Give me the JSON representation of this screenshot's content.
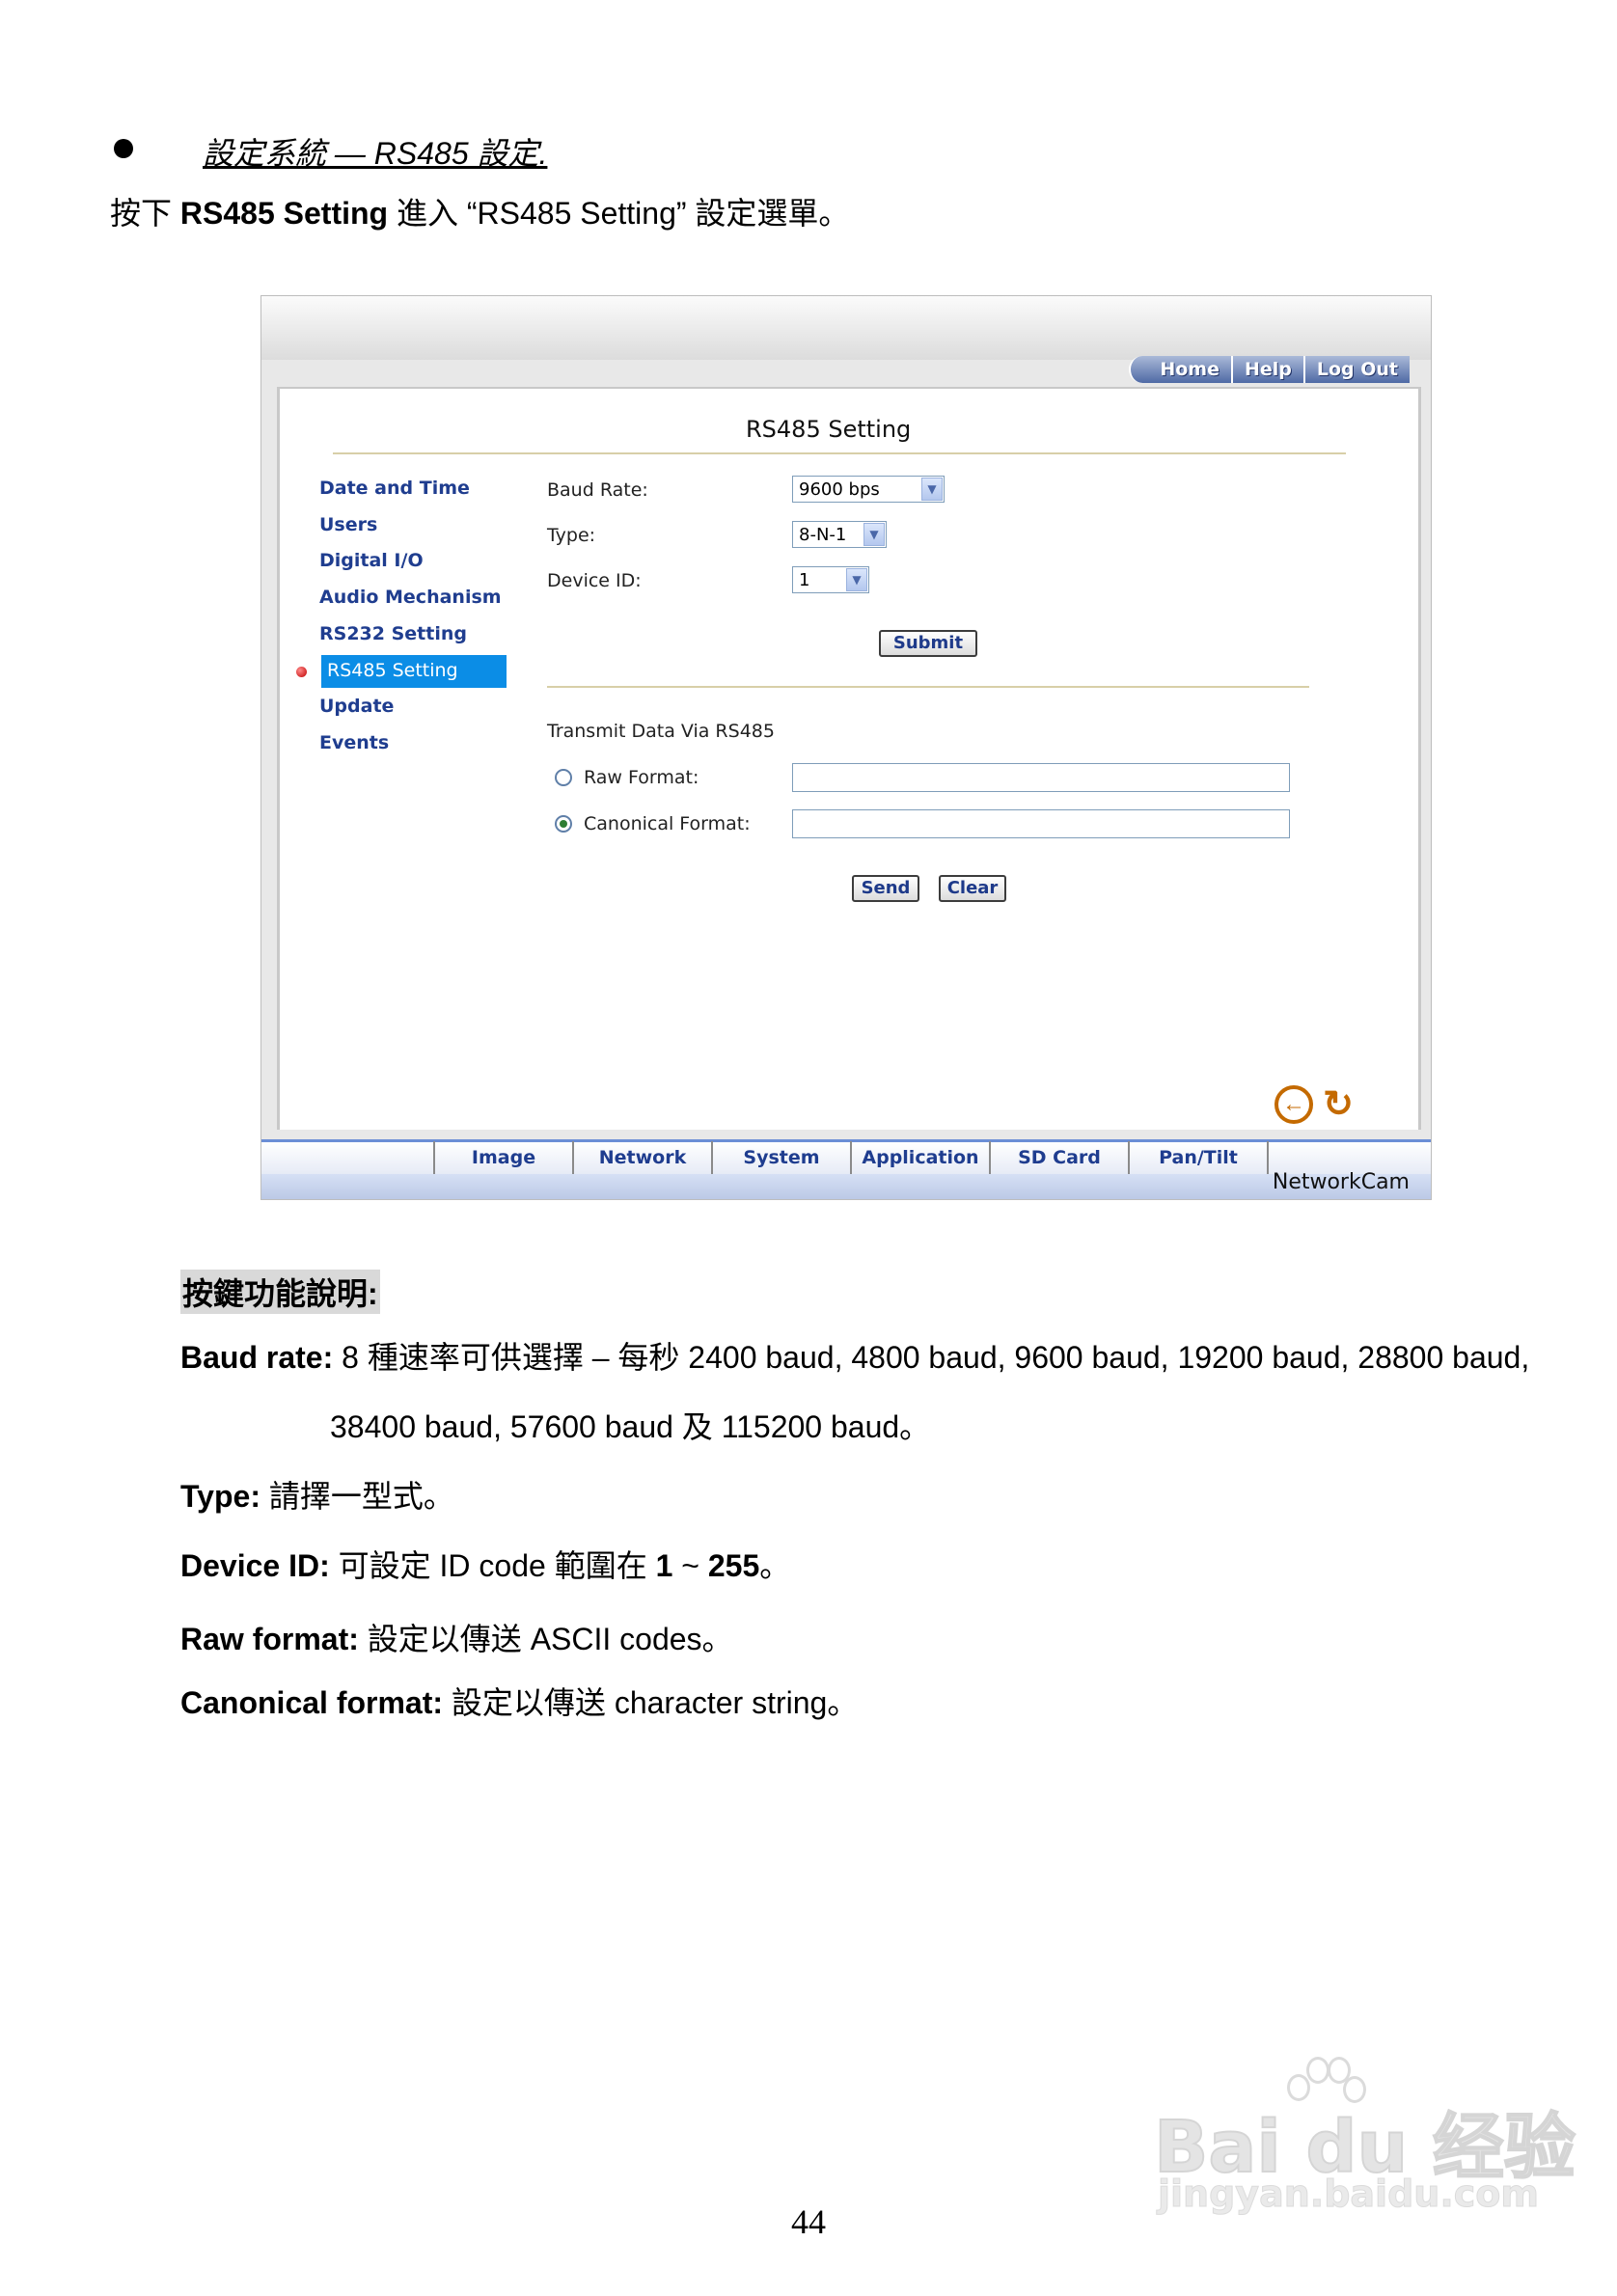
{
  "document": {
    "heading": "設定系統 — RS485 設定.",
    "intro": {
      "prefix": "按下 ",
      "bold": "RS485 Setting",
      "suffix": " 進入 “RS485 Setting” 設定選單。"
    },
    "desc_title": "按鍵功能說明:",
    "items": [
      {
        "term": "Baud rate:",
        "text": " 8 種速率可供選擇 – 每秒 2400 baud, 4800 baud, 9600 baud, 19200 baud, 28800 baud,"
      },
      {
        "term": "",
        "text": "38400 baud, 57600 baud 及 115200 baud。"
      },
      {
        "term": "Type:",
        "text": " 請擇一型式。"
      },
      {
        "term": "Device ID:",
        "text": " 可設定 ID code 範圍在 ",
        "bold1": "1",
        "mid": " ~ ",
        "bold2": "255",
        "end": "。"
      },
      {
        "term": "Raw format:",
        "text": " 設定以傳送 ASCII codes。"
      },
      {
        "term": "Canonical format:",
        "text": " 設定以傳送 character string。"
      }
    ],
    "page_number": "44"
  },
  "screenshot": {
    "top_nav": [
      "Home",
      "Help",
      "Log Out"
    ],
    "panel_title": "RS485 Setting",
    "side_menu": [
      "Date and Time",
      "Users",
      "Digital I/O",
      "Audio Mechanism",
      "RS232 Setting",
      "RS485 Setting",
      "Update",
      "Events"
    ],
    "active_item": "RS485 Setting",
    "form": {
      "baud_label": "Baud Rate:",
      "baud_value": "9600 bps",
      "type_label": "Type:",
      "type_value": "8-N-1",
      "device_label": "Device ID:",
      "device_value": "1",
      "submit": "Submit"
    },
    "transmit": {
      "title": "Transmit Data Via RS485",
      "raw_label": "Raw Format:",
      "canonical_label": "Canonical Format:",
      "selected": "Canonical Format",
      "send": "Send",
      "clear": "Clear"
    },
    "tabs": [
      "Image",
      "Network",
      "System",
      "Application",
      "SD Card",
      "Pan/Tilt"
    ],
    "brand": "NetworkCam"
  },
  "watermark": {
    "logo": "Bai du 经验",
    "url": "jingyan.baidu.com"
  },
  "colors": {
    "active_menu": "#0b8de6",
    "menu_text": "#1f3d8f",
    "icon_orange": "#c46a00"
  }
}
